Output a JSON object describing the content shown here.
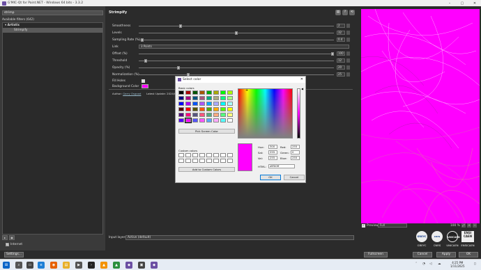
{
  "window": {
    "title": "G'MIC-Qt for Paint.NET - Windows 64 bits - 3.3.2",
    "controls": [
      "–",
      "▢",
      "✕"
    ]
  },
  "left_panel": {
    "search_value": "strimp",
    "filters_header": "Available filters (642)",
    "tree": [
      {
        "label": "▾  Artistic",
        "type": "category"
      },
      {
        "label": "Strimpify",
        "type": "filter",
        "selected": true
      }
    ],
    "internet_label": "Internet",
    "settings_label": "Settings..."
  },
  "center": {
    "filter_name": "Strimpify",
    "header_icons": [
      "▤",
      "?",
      "⟲"
    ],
    "params": [
      {
        "label": "Smoothness",
        "value": "2",
        "pos": 0.21
      },
      {
        "label": "Levels",
        "value": "32",
        "pos": 0.5
      },
      {
        "label": "Sampling Rate (%)",
        "value": "0.4",
        "pos": 0.01
      },
      {
        "label": "Link",
        "combo": "3 Points"
      },
      {
        "label": "Offset (%)",
        "value": "100",
        "pos": 1.0
      },
      {
        "label": "Threshold",
        "value": "12",
        "pos": 0.03
      },
      {
        "label": "Opacity (%)",
        "value": "20",
        "pos": 0.2
      },
      {
        "label": "Normalization (%)",
        "value": "25",
        "pos": 0.25
      },
      {
        "label": "Fill Holes",
        "checkbox": true
      },
      {
        "label": "Background Color",
        "color": "#ff00ff"
      }
    ],
    "author_prefix": "Author:",
    "author_name": "Garry Osgood",
    "latest_update": "Latest Update: 2024/03/07",
    "input_layers_label": "Input layers",
    "input_layers_value": "Active (default)"
  },
  "right": {
    "preview_label": "Preview",
    "preview_mode": "Full",
    "zoom": "100 %",
    "logos": [
      {
        "disc": "GREYC",
        "caption": "GREYC"
      },
      {
        "disc": "cnrs",
        "caption": "CNRS"
      },
      {
        "disc": "UNICAEN",
        "caption": "UNICAEN"
      },
      {
        "square": "ENSI CAEN",
        "caption": "ENSICAEN"
      }
    ]
  },
  "bottom_buttons": {
    "fullscreen": "Fullscreen",
    "cancel": "Cancel",
    "apply": "Apply",
    "ok": "OK"
  },
  "dialog": {
    "title": "Select color",
    "basic_colors_label": "Basic colors",
    "basic_colors": [
      "#000000",
      "#aa0000",
      "#005500",
      "#aa5500",
      "#00aa00",
      "#aaaa00",
      "#00ff00",
      "#aaff00",
      "#00007f",
      "#aa007f",
      "#00557f",
      "#aa557f",
      "#00aa7f",
      "#aaaa7f",
      "#00ff7f",
      "#aaff7f",
      "#0000ff",
      "#aa00ff",
      "#0055ff",
      "#aa55ff",
      "#00aaff",
      "#aaaaff",
      "#00ffff",
      "#aaffff",
      "#550000",
      "#ff0000",
      "#555500",
      "#ff5500",
      "#55aa00",
      "#ffaa00",
      "#55ff00",
      "#ffff00",
      "#55007f",
      "#ff007f",
      "#55557f",
      "#ff557f",
      "#55aa7f",
      "#ffaa7f",
      "#55ff7f",
      "#ffff7f",
      "#5500ff",
      "#ff00ff",
      "#5555ff",
      "#ff55ff",
      "#55aaff",
      "#ffaaff",
      "#55ffff",
      "#ffffff"
    ],
    "pick_screen_label": "Pick Screen Color",
    "custom_colors_label": "Custom colors",
    "add_custom_label": "Add to Custom Colors",
    "current_color": "#ff00ff",
    "hue_label": "Hue:",
    "hue": "300",
    "sat_label": "Sat:",
    "sat": "255",
    "val_label": "Val:",
    "val": "255",
    "red_label": "Red:",
    "red": "255",
    "green_label": "Green:",
    "green": "0",
    "blue_label": "Blue:",
    "blue": "255",
    "html_label": "HTML:",
    "html": "#ff00ff",
    "ok": "OK",
    "cancel": "Cancel"
  },
  "taskbar": {
    "time": "4:25 PM",
    "date": "1/11/2025"
  }
}
